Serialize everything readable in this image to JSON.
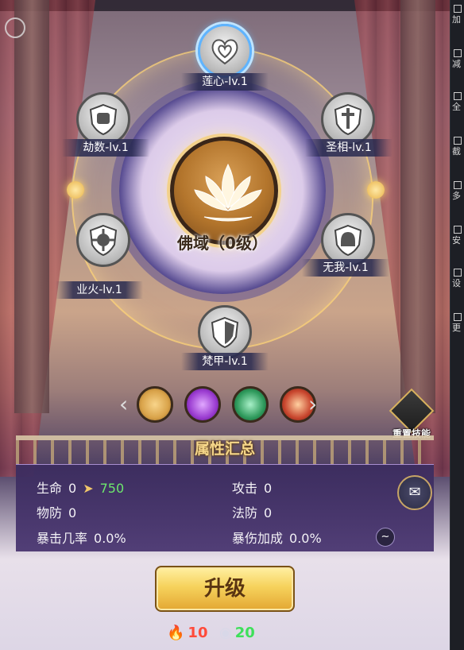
{
  "core": {
    "label": "佛域（0级）"
  },
  "skills": [
    {
      "name": "莲心-lv.1",
      "active": true,
      "icon": "heart-icon"
    },
    {
      "name": "劫数-lv.1",
      "active": false,
      "icon": "fist-shield-icon"
    },
    {
      "name": "圣相-lv.1",
      "active": false,
      "icon": "sword-shield-icon"
    },
    {
      "name": "业火-lv.1",
      "active": false,
      "icon": "burst-shield-icon"
    },
    {
      "name": "无我-lv.1",
      "active": false,
      "icon": "helmet-shield-icon"
    },
    {
      "name": "梵甲-lv.1",
      "active": false,
      "icon": "half-shield-icon"
    }
  ],
  "elements": [
    {
      "icon": "golden-lotus-icon",
      "color": "#d9a34a"
    },
    {
      "icon": "purple-flame-icon",
      "color": "#9a3bd0"
    },
    {
      "icon": "green-eye-icon",
      "color": "#2f9a5c"
    },
    {
      "icon": "red-swirl-icon",
      "color": "#c8462e"
    }
  ],
  "reset": {
    "label": "重置技能"
  },
  "stats": {
    "title": "属性汇总",
    "hp": {
      "label": "生命",
      "value": "0",
      "next": "750"
    },
    "attack": {
      "label": "攻击",
      "value": "0"
    },
    "pdef": {
      "label": "物防",
      "value": "0"
    },
    "mdef": {
      "label": "法防",
      "value": "0"
    },
    "crit_rate": {
      "label": "暴击几率",
      "value": "0.0%"
    },
    "crit_dmg": {
      "label": "暴伤加成",
      "value": "0.0%"
    }
  },
  "tilde": "~",
  "upgrade": {
    "label": "升级"
  },
  "costs": [
    {
      "icon": "blue-flame-icon",
      "value": "10",
      "color": "#ff4a3a"
    },
    {
      "icon": "coin-icon",
      "value": "20",
      "color": "#3ee05a"
    }
  ],
  "sidebar": {
    "items": [
      "加",
      "减",
      "全",
      "截",
      "多",
      "安",
      "设",
      "更"
    ]
  }
}
